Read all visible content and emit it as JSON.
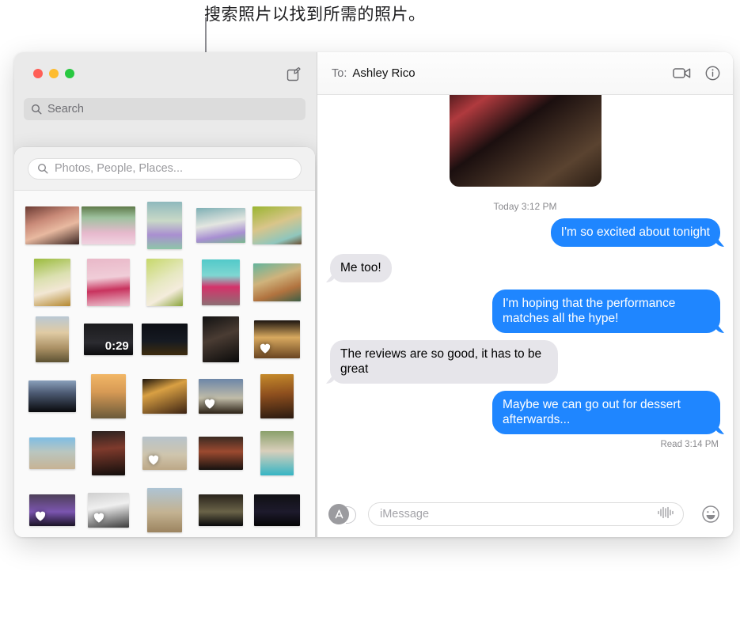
{
  "callout": {
    "text": "搜索照片以找到所需的照片。"
  },
  "sidebar": {
    "search": {
      "placeholder": "Search",
      "icon": "search-icon"
    },
    "compose_icon": "compose-icon",
    "traffic_lights": [
      "close-red",
      "minimize-yellow",
      "zoom-green"
    ]
  },
  "photo_picker": {
    "search": {
      "placeholder": "Photos, People, Places...",
      "icon": "search-icon"
    },
    "photos": [
      {
        "id": "p1",
        "w": 68,
        "h": 48,
        "bg": "linear-gradient(160deg,#6b3b33 0%,#c98a78 35%,#e8b9a0 60%,#3a2420 100%)",
        "heart": false,
        "duration": null
      },
      {
        "id": "p2",
        "w": 68,
        "h": 48,
        "bg": "linear-gradient(180deg,#5f7a4a 0%,#9fc2a0 30%,#e7b9cd 70%,#f0d3e0 100%)",
        "heart": false,
        "duration": null
      },
      {
        "id": "p3",
        "w": 44,
        "h": 60,
        "bg": "linear-gradient(180deg,#8fb9bd 0%,#c9d9c7 40%,#a98fd0 70%,#8ec6a8 100%)",
        "heart": false,
        "duration": null
      },
      {
        "id": "p4",
        "w": 62,
        "h": 44,
        "bg": "linear-gradient(170deg,#7fb0b5 0%,#e3e6e0 45%,#a88fd2 75%,#79b98e 100%)",
        "heart": false,
        "duration": null
      },
      {
        "id": "p5",
        "w": 62,
        "h": 48,
        "bg": "linear-gradient(160deg,#9ab531 0%,#d9c58a 45%,#8fc6bd 80%,#6d5134 100%)",
        "heart": false,
        "duration": null
      },
      {
        "id": "p6",
        "w": 46,
        "h": 60,
        "bg": "linear-gradient(165deg,#9bbb3d 0%,#dbe0b0 40%,#f2e7d4 65%,#b4882f 100%)",
        "heart": false,
        "duration": null
      },
      {
        "id": "p7",
        "w": 54,
        "h": 60,
        "bg": "linear-gradient(175deg,#e9b8c8 0%,#f0cdd8 40%,#c8335e 65%,#ecc3cf 100%)",
        "heart": false,
        "duration": null
      },
      {
        "id": "p8",
        "w": 46,
        "h": 60,
        "bg": "linear-gradient(150deg,#c6d86a 0%,#e6e8c0 45%,#f4ecdc 70%,#8aa43a 100%)",
        "heart": false,
        "duration": null
      },
      {
        "id": "p9",
        "w": 48,
        "h": 58,
        "bg": "linear-gradient(180deg,#52c9c9 0%,#7fd7d2 35%,#d4326a 60%,#8d6f74 100%)",
        "heart": false,
        "duration": null
      },
      {
        "id": "p10",
        "w": 60,
        "h": 48,
        "bg": "linear-gradient(160deg,#63b49c 0%,#cfb37c 40%,#b1733f 70%,#3e5f46 100%)",
        "heart": false,
        "duration": null
      },
      {
        "id": "p11",
        "w": 42,
        "h": 58,
        "bg": "linear-gradient(180deg,#b9c8d4 0%,#e0cba4 35%,#a98f63 70%,#5d5233 100%)",
        "heart": false,
        "duration": null
      },
      {
        "id": "p12",
        "w": 62,
        "h": 40,
        "bg": "linear-gradient(180deg,#1b1b1d 0%,#2b2b30 60%,#0c0c0e 100%)",
        "heart": false,
        "duration": "0:29"
      },
      {
        "id": "p13",
        "w": 58,
        "h": 40,
        "bg": "linear-gradient(180deg,#0c0e14 0%,#161a22 55%,#3a2a10 95%)",
        "heart": false,
        "duration": null
      },
      {
        "id": "p14",
        "w": 46,
        "h": 58,
        "bg": "linear-gradient(160deg,#121212 0%,#4a3c33 45%,#0a0a0a 100%)",
        "heart": false,
        "duration": null
      },
      {
        "id": "p15",
        "w": 58,
        "h": 48,
        "bg": "linear-gradient(180deg,#1c1510 0%,#d8a95f 45%,#6a4521 100%)",
        "heart": true,
        "duration": null
      },
      {
        "id": "p16",
        "w": 60,
        "h": 40,
        "bg": "linear-gradient(180deg,#8aa0bb 0%,#4c5a72 40%,#08090c 100%)",
        "heart": false,
        "duration": null
      },
      {
        "id": "p17",
        "w": 44,
        "h": 56,
        "bg": "linear-gradient(180deg,#f2b766 0%,#d79a55 40%,#6b5a3a 100%)",
        "heart": false,
        "duration": null
      },
      {
        "id": "p18",
        "w": 56,
        "h": 44,
        "bg": "linear-gradient(160deg,#1d140c 0%,#d9a043 35%,#3d2413 100%)",
        "heart": false,
        "duration": null
      },
      {
        "id": "p19",
        "w": 56,
        "h": 44,
        "bg": "linear-gradient(180deg,#6d86a8 0%,#c0bca8 55%,#2a2014 100%)",
        "heart": true,
        "duration": null
      },
      {
        "id": "p20",
        "w": 42,
        "h": 56,
        "bg": "linear-gradient(175deg,#c68b2b 0%,#8e4f1e 45%,#2b1a10 100%)",
        "heart": false,
        "duration": null
      },
      {
        "id": "p21",
        "w": 58,
        "h": 40,
        "bg": "linear-gradient(180deg,#7fbde4 0%,#b9c6c0 45%,#c7b394 100%)",
        "heart": false,
        "duration": null
      },
      {
        "id": "p22",
        "w": 42,
        "h": 56,
        "bg": "linear-gradient(175deg,#2a2220 0%,#7e3a2c 40%,#120e0c 100%)",
        "heart": false,
        "duration": null
      },
      {
        "id": "p23",
        "w": 56,
        "h": 42,
        "bg": "linear-gradient(180deg,#b7c3cb 0%,#cfc5ad 55%,#bda887 100%)",
        "heart": true,
        "duration": null
      },
      {
        "id": "p24",
        "w": 56,
        "h": 42,
        "bg": "linear-gradient(180deg,#3a2a22 0%,#9c4a30 45%,#161210 100%)",
        "heart": false,
        "duration": null
      },
      {
        "id": "p25",
        "w": 42,
        "h": 56,
        "bg": "linear-gradient(180deg,#8aa06b 0%,#d9cfbb 45%,#35b5c4 100%)",
        "heart": false,
        "duration": null
      },
      {
        "id": "p26",
        "w": 58,
        "h": 40,
        "bg": "linear-gradient(180deg,#4e3f58 0%,#7b55b0 55%,#1b1426 100%)",
        "heart": true,
        "duration": null
      },
      {
        "id": "p27",
        "w": 52,
        "h": 44,
        "bg": "linear-gradient(170deg,#cfcfcf 0%,#efefef 40%,#3a3a3a 100%)",
        "heart": true,
        "duration": null
      },
      {
        "id": "p28",
        "w": 44,
        "h": 56,
        "bg": "linear-gradient(180deg,#aec4d4 0%,#c3b291 55%,#9c8460 100%)",
        "heart": false,
        "duration": null
      },
      {
        "id": "p29",
        "w": 56,
        "h": 40,
        "bg": "linear-gradient(180deg,#2a241c 0%,#6a6348 55%,#08090a 100%)",
        "heart": false,
        "duration": null
      },
      {
        "id": "p30",
        "w": 58,
        "h": 40,
        "bg": "linear-gradient(180deg,#101014 0%,#1d1a2c 55%,#050506 100%)",
        "heart": false,
        "duration": null
      },
      {
        "id": "p31",
        "w": 44,
        "h": 56,
        "bg": "linear-gradient(180deg,#4b4238 0%,#a3522e 45%,#17120f 100%)",
        "heart": true,
        "duration": null
      },
      {
        "id": "p32",
        "w": 56,
        "h": 42,
        "bg": "linear-gradient(180deg,#1a1512 0%,#6a3a22 50%,#0b0908 100%)",
        "heart": false,
        "duration": null
      },
      {
        "id": "p33",
        "w": 56,
        "h": 40,
        "bg": "linear-gradient(180deg,#cfd3d6 0%,#cbb893 55%,#b49f78 100%)",
        "heart": false,
        "duration": null
      },
      {
        "id": "p34",
        "w": 44,
        "h": 56,
        "bg": "linear-gradient(170deg,#e9e9e9 0%,#9a9a9a 45%,#2a2a2a 100%)",
        "heart": false,
        "duration": null
      },
      {
        "id": "p35",
        "w": 56,
        "h": 40,
        "bg": "linear-gradient(180deg,#9fb0bb 0%,#c4b695 60%,#b0a383 100%)",
        "heart": false,
        "duration": null
      }
    ]
  },
  "conversation": {
    "to_label": "To:",
    "recipient": "Ashley Rico",
    "facetime_icon": "video-camera-icon",
    "info_icon": "info-icon",
    "attachment": {
      "name": "photo-attachment",
      "bg": "linear-gradient(145deg,#3a1214 0%,#b03a3e 18%,#1b0f0f 42%,#5a4330 78%,#2a1d14 100%)"
    },
    "timestamp": "Today 3:12 PM",
    "messages": [
      {
        "text": "I'm so excited about tonight",
        "side": "out"
      },
      {
        "text": "Me too!",
        "side": "in"
      },
      {
        "text": "I'm hoping that the performance matches all the hype!",
        "side": "out"
      },
      {
        "text": "The reviews are so good, it has to be great",
        "side": "in"
      },
      {
        "text": "Maybe we can go out for dessert afterwards...",
        "side": "out"
      }
    ],
    "read_receipt": "Read 3:14 PM",
    "composer": {
      "apps_icon": "app-store-icon",
      "placeholder": "iMessage",
      "audio_icon": "audio-waveform-icon",
      "emoji_icon": "emoji-smiley-icon"
    }
  },
  "colors": {
    "bubble_out": "#1f86ff",
    "bubble_in": "#e6e5ea",
    "sidebar_bg": "#eaeaea",
    "traffic_red": "#ff5f57",
    "traffic_yellow": "#febc2e",
    "traffic_green": "#28c840"
  }
}
